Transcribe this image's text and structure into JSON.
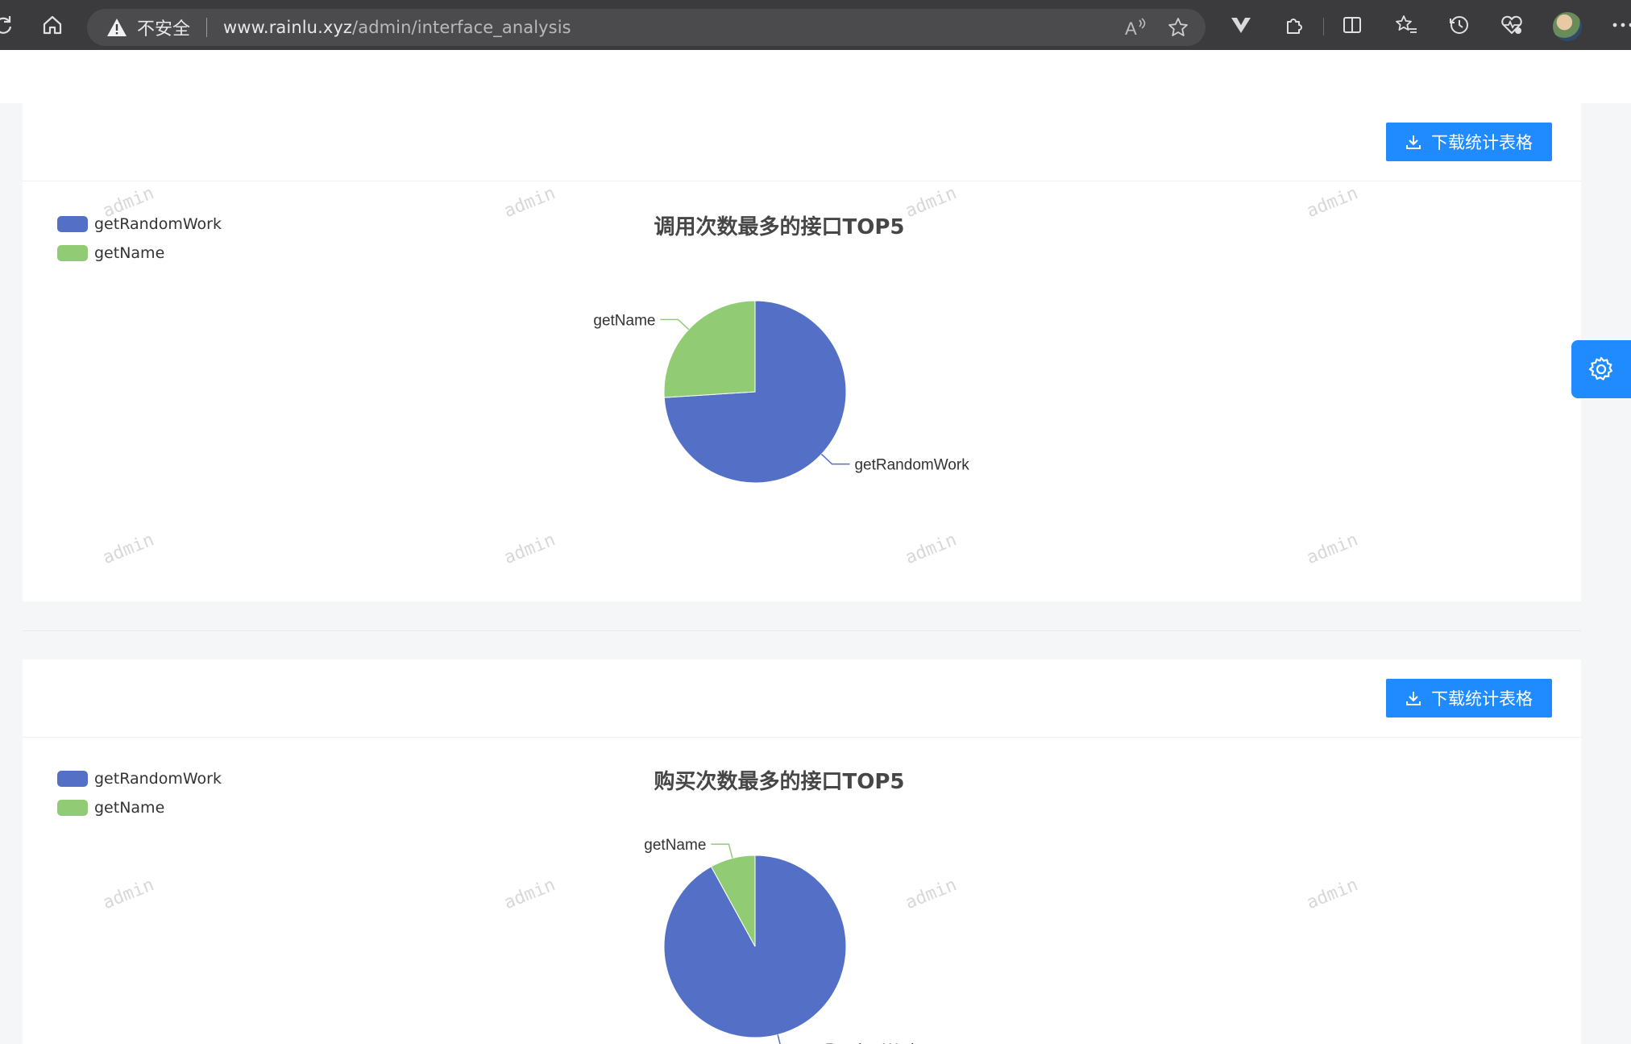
{
  "browser": {
    "insecure_label": "不安全",
    "url_host": "www.rainlu.xyz",
    "url_path": "/admin/interface_analysis",
    "read_aloud_label": "A",
    "icons": [
      "refresh-icon",
      "home-icon",
      "warning-icon",
      "read-aloud-icon",
      "favorite-star-icon",
      "vue-devtools-icon",
      "extensions-icon",
      "split-screen-icon",
      "favorites-icon",
      "history-icon",
      "performance-icon",
      "profile-avatar"
    ]
  },
  "colors": {
    "accent": "#1f8bff",
    "series_blue": "#5470c6",
    "series_green": "#91cc75"
  },
  "watermark_text": "admin",
  "cards": [
    {
      "download_label": "下载统计表格",
      "chart_title": "调用次数最多的接口TOP5",
      "legend": [
        "getRandomWork",
        "getName"
      ]
    },
    {
      "download_label": "下载统计表格",
      "chart_title": "购买次数最多的接口TOP5",
      "legend": [
        "getRandomWork",
        "getName"
      ]
    }
  ],
  "chart_data": [
    {
      "type": "pie",
      "title": "调用次数最多的接口TOP5",
      "legend_position": "top-left",
      "categories": [
        "getRandomWork",
        "getName"
      ],
      "values": [
        74,
        26
      ]
    },
    {
      "type": "pie",
      "title": "购买次数最多的接口TOP5",
      "legend_position": "top-left",
      "categories": [
        "getRandomWork",
        "getName"
      ],
      "values": [
        92,
        8
      ]
    }
  ]
}
